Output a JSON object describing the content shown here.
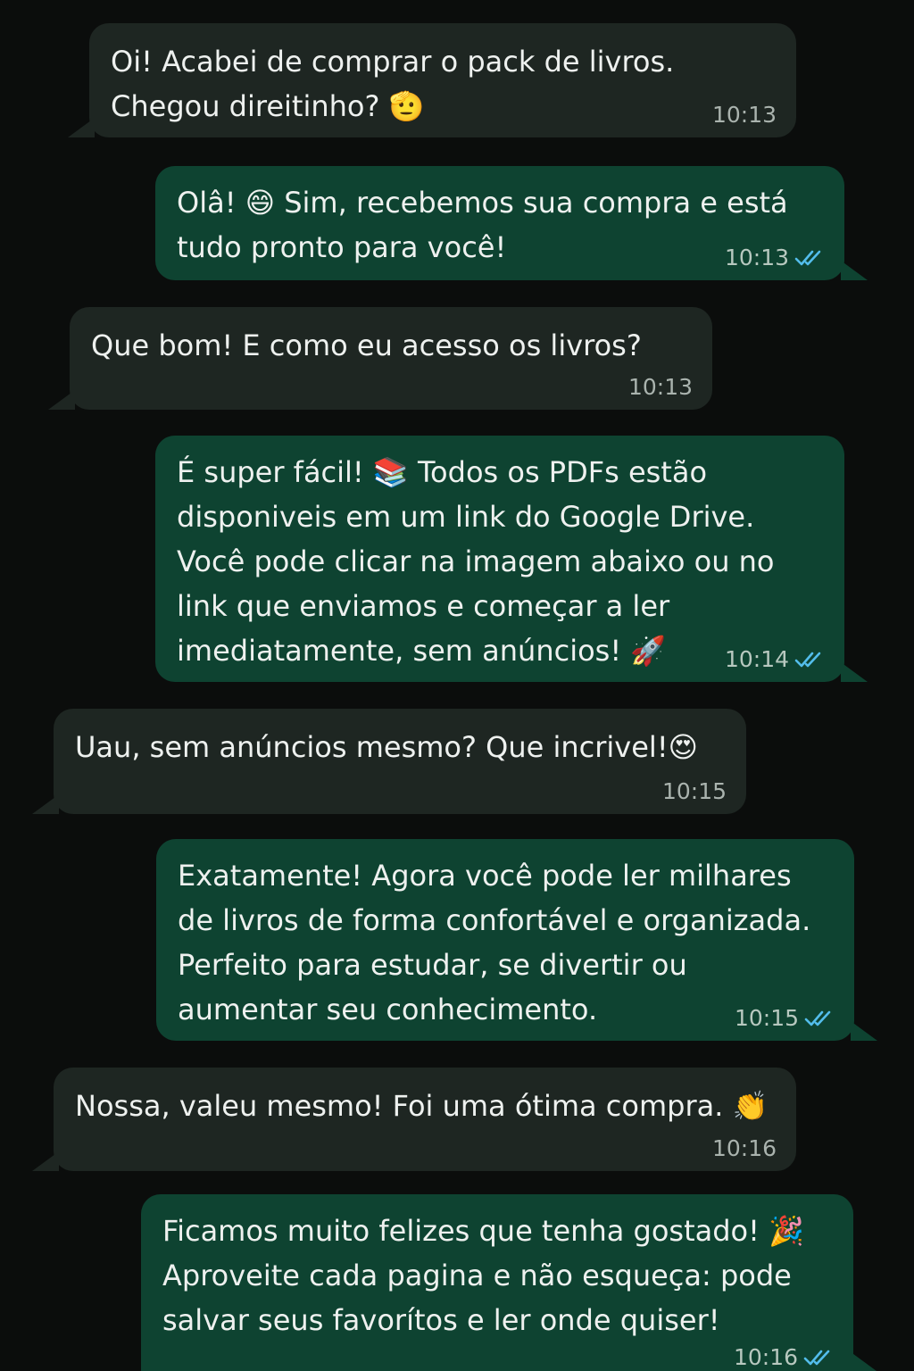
{
  "conversation": {
    "messages": [
      {
        "direction": "incoming",
        "text": "Oi! Acabei de comprar o pack de livros.\nChegou direitinho? 🫡",
        "time": "10:13"
      },
      {
        "direction": "outgoing",
        "text": "Olâ! 😄 Sim, recebemos sua compra e está\ntudo pronto para você!",
        "time": "10:13",
        "status": "read"
      },
      {
        "direction": "incoming",
        "text": "Que bom! E como eu acesso os livros?",
        "time": "10:13"
      },
      {
        "direction": "outgoing",
        "text": "É super fácil! 📚 Todos os PDFs estão\ndisponiveis em um link do Google Drive.\nVocê pode clicar na imagem abaixo ou no\nlink que enviamos e começar a ler\nimediatamente, sem anúncios! 🚀",
        "time": "10:14",
        "status": "read"
      },
      {
        "direction": "incoming",
        "text": "Uau, sem anúncios mesmo? Que incrivel!😍",
        "time": "10:15"
      },
      {
        "direction": "outgoing",
        "text": "Exatamente! Agora você pode ler milhares\nde livros de forma confortável e organizada.\nPerfeito para estudar, se divertir ou\naumentar seu conhecimento.",
        "time": "10:15",
        "status": "read"
      },
      {
        "direction": "incoming",
        "text": "Nossa, valeu mesmo! Foi uma ótima compra. 👏",
        "time": "10:16"
      },
      {
        "direction": "outgoing",
        "text": "Ficamos muito felizes que tenha gostado! 🎉\nAproveite cada pagina e não esqueça: pode\nsalvar seus favorítos e ler onde quiser!",
        "time": "10:16",
        "status": "read"
      }
    ]
  },
  "colors": {
    "background": "#0b0d0c",
    "incoming_bubble": "#1e2622",
    "outgoing_bubble": "#0e4331",
    "read_ticks": "#53bdeb",
    "timestamp": "#aab3ae"
  },
  "icons": {
    "read_status": "double-check-icon"
  }
}
